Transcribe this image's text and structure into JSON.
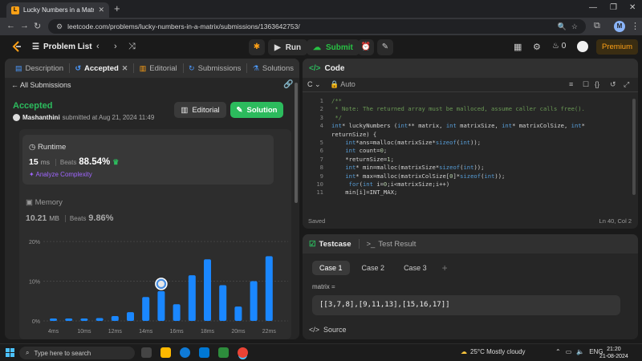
{
  "browser": {
    "tab_title": "Lucky Numbers in a Matrix - Le",
    "url": "leetcode.com/problems/lucky-numbers-in-a-matrix/submissions/1363642753/",
    "profile_letter": "M"
  },
  "header": {
    "problem_list": "Problem List",
    "run_label": "Run",
    "submit_label": "Submit",
    "streak_count": "0",
    "premium_label": "Premium"
  },
  "left_tabs": [
    {
      "label": "Description"
    },
    {
      "label": "Accepted"
    },
    {
      "label": "Editorial"
    },
    {
      "label": "Submissions"
    },
    {
      "label": "Solutions"
    }
  ],
  "submission": {
    "all_label": "All Submissions",
    "status": "Accepted",
    "user": "Mashanthini",
    "submitted_text": "submitted at Aug 21, 2024 11:49",
    "editorial_btn": "Editorial",
    "solution_btn": "Solution",
    "runtime": {
      "label": "Runtime",
      "value": "15",
      "unit": "ms",
      "beats_label": "Beats",
      "beats": "88.54%",
      "analyze": "Analyze Complexity"
    },
    "memory": {
      "label": "Memory",
      "value": "10.21",
      "unit": "MB",
      "beats_label": "Beats",
      "beats": "9.86%"
    }
  },
  "chart_data": {
    "type": "bar",
    "y_ticks": [
      "20%",
      "10%",
      "0%"
    ],
    "ylim": [
      0,
      20
    ],
    "x_ticks": [
      "4ms",
      "10ms",
      "12ms",
      "14ms",
      "16ms",
      "18ms",
      "20ms",
      "22ms"
    ],
    "values": [
      0.6,
      0.6,
      0.6,
      0.7,
      1.2,
      2.2,
      6.0,
      7.5,
      4.2,
      11.5,
      15.5,
      9.0,
      3.6,
      10.0,
      16.3
    ],
    "highlight_index": 7,
    "bar_color": "#1a87ff"
  },
  "code": {
    "title": "Code",
    "language": "C",
    "auto_label": "Auto",
    "lines": [
      {
        "n": "1",
        "html": "<span class='cm'>/**</span>"
      },
      {
        "n": "2",
        "html": "<span class='cm'> * Note: The returned array must be malloced, assume caller calls free().</span>"
      },
      {
        "n": "3",
        "html": "<span class='cm'> */</span>"
      },
      {
        "n": "4",
        "html": "<span class='kw'>int</span><span class='tx'>* luckyNumbers (</span><span class='kw'>int</span><span class='tx'>** matrix, </span><span class='kw'>int</span><span class='tx'> matrixSize, </span><span class='kw'>int</span><span class='tx'>* matrixColSize, </span><span class='kw'>int</span><span class='tx'>*</span>"
      },
      {
        "n": "",
        "html": "<span class='tx'>returnSize) {</span>"
      },
      {
        "n": "5",
        "html": "<span class='tx'>    </span><span class='kw'>int</span><span class='tx'>*ans=malloc(matrixSize*</span><span class='kw'>sizeof</span><span class='tx'>(</span><span class='kw'>int</span><span class='tx'>));</span>"
      },
      {
        "n": "6",
        "html": "<span class='tx'>    </span><span class='kw'>int</span><span class='tx'> count=</span><span class='nm'>0</span><span class='tx'>;</span>"
      },
      {
        "n": "7",
        "html": "<span class='tx'>    *returnSize=</span><span class='nm'>1</span><span class='tx'>;</span>"
      },
      {
        "n": "8",
        "html": "<span class='tx'>    </span><span class='kw'>int</span><span class='tx'>* min=malloc(matrixSize*</span><span class='kw'>sizeof</span><span class='tx'>(</span><span class='kw'>int</span><span class='tx'>));</span>"
      },
      {
        "n": "9",
        "html": "<span class='tx'>    </span><span class='kw'>int</span><span class='tx'>* max=malloc(matrixColSize[</span><span class='nm'>0</span><span class='tx'>]*</span><span class='kw'>sizeof</span><span class='tx'>(</span><span class='kw'>int</span><span class='tx'>));</span>"
      },
      {
        "n": "10",
        "html": "<span class='tx'>     </span><span class='kw'>for</span><span class='tx'>(</span><span class='kw'>int</span><span class='tx'> i=</span><span class='nm'>0</span><span class='tx'>;i&lt;matrixSize;i++)</span>"
      },
      {
        "n": "11",
        "html": "<span class='tx'>    min[i]=INT_MAX;</span>"
      }
    ],
    "saved": "Saved",
    "cursor": "Ln 40, Col 2"
  },
  "testcase": {
    "tab_active": "Testcase",
    "tab_result": "Test Result",
    "cases": [
      "Case 1",
      "Case 2",
      "Case 3"
    ],
    "param_label": "matrix =",
    "param_value": "[[3,7,8],[9,11,13],[15,16,17]]",
    "source_label": "Source"
  },
  "taskbar": {
    "search_placeholder": "Type here to search",
    "weather": "25°C  Mostly cloudy",
    "lang": "ENG",
    "time": "21:20",
    "date": "21-08-2024"
  }
}
